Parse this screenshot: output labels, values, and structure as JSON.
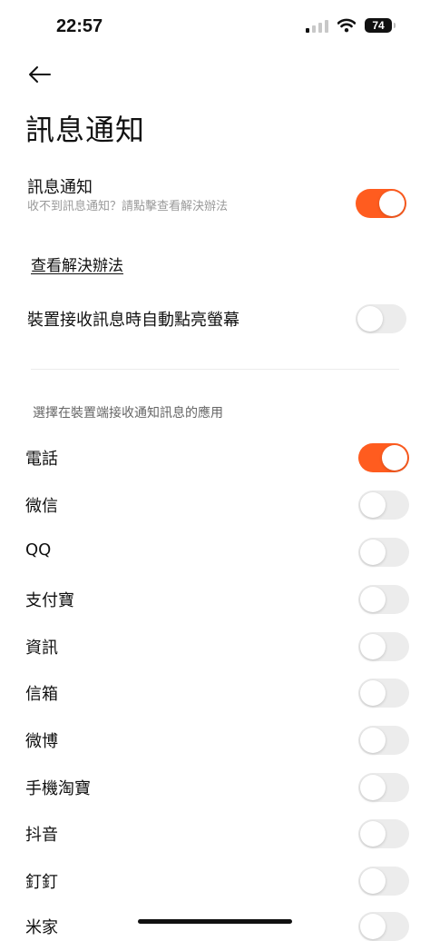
{
  "status_bar": {
    "time": "22:57",
    "battery": "74"
  },
  "header": {
    "title": "訊息通知"
  },
  "notification": {
    "label": "訊息通知",
    "subtitle": "收不到訊息通知？請點擊查看解決辦法",
    "enabled": true
  },
  "help_link": "查看解決辦法",
  "wake_screen": {
    "label": "裝置接收訊息時自動點亮螢幕",
    "enabled": false
  },
  "apps_section": {
    "heading": "選擇在裝置端接收通知訊息的應用",
    "apps": [
      {
        "label": "電話",
        "enabled": true
      },
      {
        "label": "微信",
        "enabled": false
      },
      {
        "label": "QQ",
        "enabled": false
      },
      {
        "label": "支付寶",
        "enabled": false
      },
      {
        "label": "資訊",
        "enabled": false
      },
      {
        "label": "信箱",
        "enabled": false
      },
      {
        "label": "微博",
        "enabled": false
      },
      {
        "label": "手機淘寶",
        "enabled": false
      },
      {
        "label": "抖音",
        "enabled": false
      },
      {
        "label": "釘釘",
        "enabled": false
      },
      {
        "label": "米家",
        "enabled": false
      }
    ]
  },
  "colors": {
    "accent": "#ff5c1f",
    "toggle_off": "#ececec"
  }
}
